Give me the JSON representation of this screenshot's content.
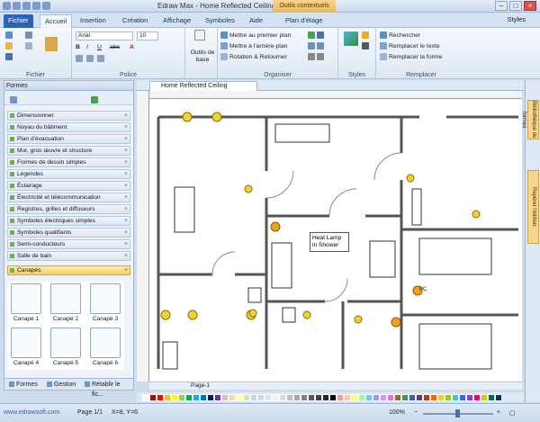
{
  "title_bar": {
    "title": "Edraw Max - Home Reflected Ceiling Plan.eddx",
    "context_tab": "Outils contextuels",
    "window_controls": [
      "minimize-icon",
      "maximize-icon",
      "close-icon"
    ]
  },
  "ribbon_tabs": [
    "Fichier",
    "Accueil",
    "Insertion",
    "Création",
    "Affichage",
    "Symboles",
    "Aide",
    "Plan d'étage"
  ],
  "styles_link": "Styles",
  "ribbon": {
    "fichier_group": "Fichier",
    "police": {
      "label": "Police",
      "font_name": "Arial",
      "font_size": "10",
      "format_buttons": [
        "B",
        "I",
        "U",
        "abc",
        "A"
      ]
    },
    "outils": {
      "label_line1": "Outils de",
      "label_line2": "base"
    },
    "organiser": {
      "label": "Organiser",
      "items": [
        "Mettre au premier plan",
        "Mettre à l'arrière-plan",
        "Rotation & Retourner"
      ]
    },
    "styles": {
      "label": "Styles"
    },
    "remplacer": {
      "label": "Remplacer",
      "items": [
        "Rechercher",
        "Remplacer le texte",
        "Remplacer la forme"
      ]
    }
  },
  "left_panel": {
    "title": "Formes",
    "categories": [
      "Dimensionner",
      "Noyau du bâtiment",
      "Plan d'évacuation",
      "Mur, gros œuvre et structure",
      "Formes de dessin simples",
      "Légendes",
      "Éclairage",
      "Électricité et télécommunication",
      "Registres, grilles et diffuseurs",
      "Symboles électriques simples",
      "Symboles qualifiants",
      "Semi-conducteurs",
      "Salle de bain",
      "Canapés"
    ],
    "shapes": [
      "Canapé 1",
      "Canapé 2",
      "Canapé 3",
      "Canapé 4",
      "Canapé 5",
      "Canapé 6"
    ],
    "bottom_tabs": [
      "Formes",
      "Gestion",
      "Rétablir le fic..."
    ]
  },
  "document": {
    "tab_title": "Home Reflected Ceiling Plan.eddx",
    "page_tab": "Page-1",
    "callout": {
      "line1": "Heat Lamp",
      "line2": "in Shower"
    },
    "labels": [
      "PC",
      "NP",
      "NP"
    ]
  },
  "right_dock": [
    "Bibliothèque de formes",
    "Repérer l'édition"
  ],
  "palette_colors": [
    "#ffffff",
    "#c00000",
    "#ff0000",
    "#ffc000",
    "#ffff00",
    "#92d050",
    "#00b050",
    "#00b0f0",
    "#0070c0",
    "#002060",
    "#7030a0",
    "#e6b8b7",
    "#fbd4b4",
    "#ffff99",
    "#d8e4bc",
    "#b7dee8",
    "#c5d9f1",
    "#e4dfec",
    "#f2f2f2",
    "#d9d9d9",
    "#bfbfbf",
    "#a6a6a6",
    "#808080",
    "#595959",
    "#404040",
    "#262626",
    "#000000",
    "#ff9999",
    "#ffcc99",
    "#ffff66",
    "#99ff99",
    "#66ccff",
    "#9999ff",
    "#cc99ff",
    "#ff66cc",
    "#996633",
    "#339966",
    "#336699",
    "#663399",
    "#cc3300",
    "#ff6600",
    "#ffcc00",
    "#99cc00",
    "#33cccc",
    "#3366ff",
    "#9933ff",
    "#ff0066",
    "#cccc00",
    "#006666",
    "#003366"
  ],
  "status": {
    "url": "www.edrawsoft.com",
    "page": "Page 1/1",
    "coords": "X=8, Y=6",
    "zoom": "100%"
  }
}
